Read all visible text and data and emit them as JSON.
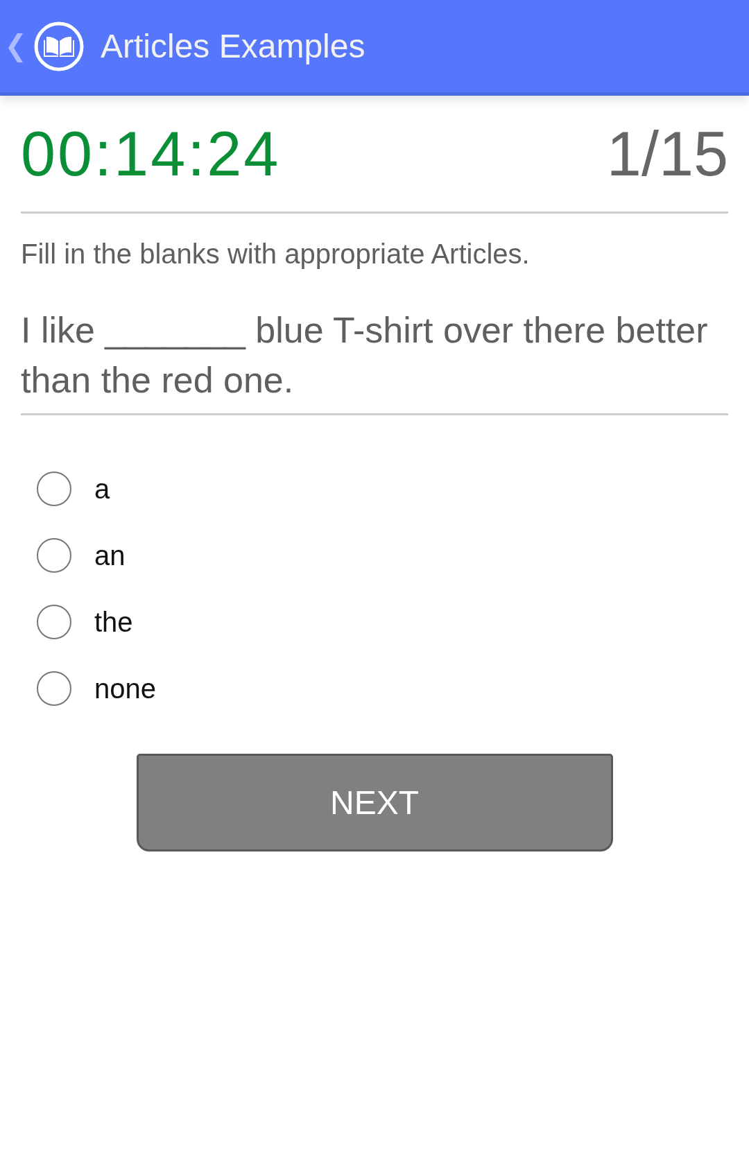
{
  "header": {
    "title": "Articles Examples"
  },
  "quiz": {
    "timer": "00:14:24",
    "progress": "1/15",
    "instruction": "Fill in the blanks with appropriate Articles.",
    "question": "I like _______ blue T-shirt over there better than the red one."
  },
  "options": [
    {
      "label": "a",
      "selected": false
    },
    {
      "label": "an",
      "selected": false
    },
    {
      "label": "the",
      "selected": false
    },
    {
      "label": "none",
      "selected": false
    }
  ],
  "next_button": {
    "label": "NEXT"
  }
}
